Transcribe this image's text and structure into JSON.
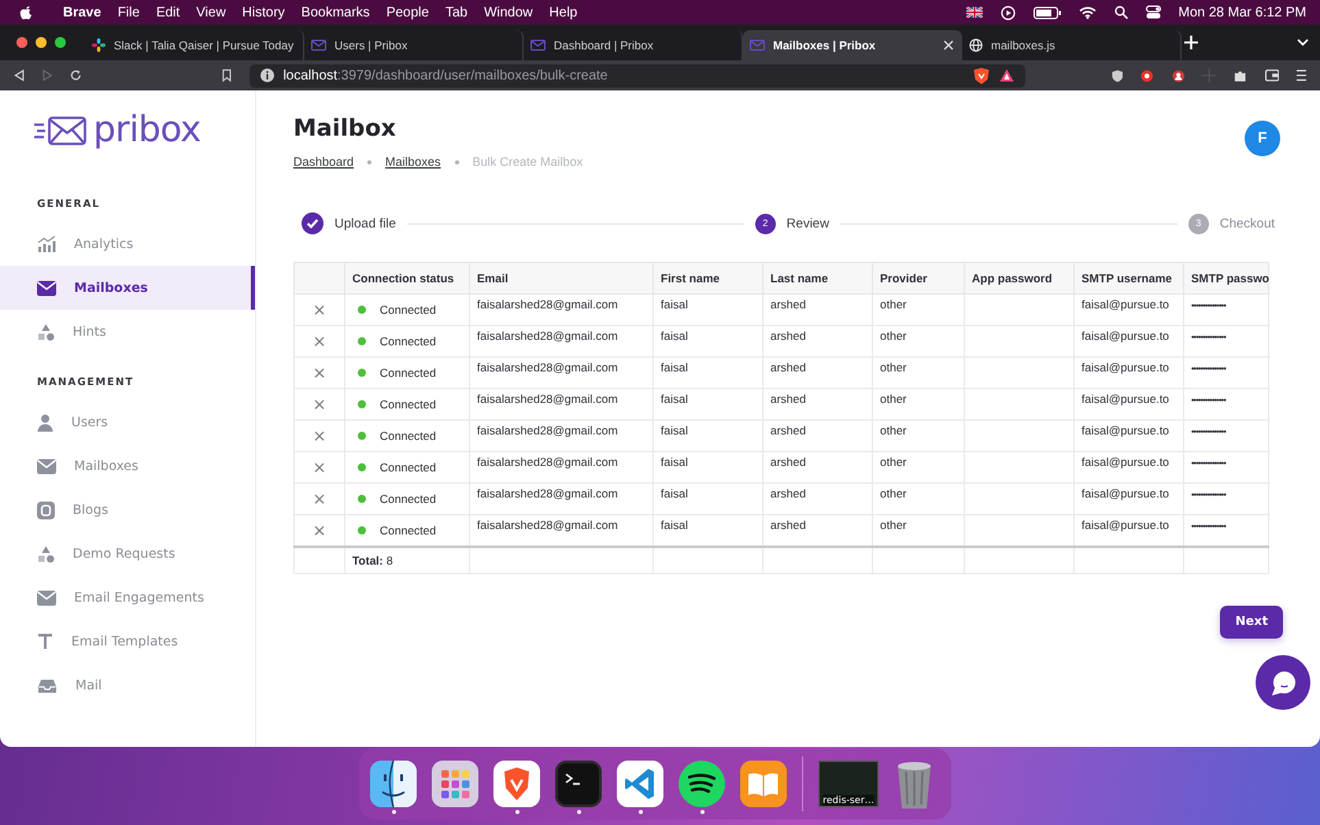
{
  "menubar": {
    "app": "Brave",
    "menus": [
      "File",
      "Edit",
      "View",
      "History",
      "Bookmarks",
      "People",
      "Tab",
      "Window",
      "Help"
    ],
    "clock": "Mon 28 Mar  6:12 PM"
  },
  "tabs": [
    {
      "title": "Slack | Talia Qaiser | Pursue Today",
      "kind": "slack",
      "selected": false
    },
    {
      "title": "Users | Pribox",
      "kind": "pribox",
      "selected": false
    },
    {
      "title": "Dashboard | Pribox",
      "kind": "pribox",
      "selected": false
    },
    {
      "title": "Mailboxes | Pribox",
      "kind": "pribox",
      "selected": true
    },
    {
      "title": "mailboxes.js",
      "kind": "web",
      "selected": false
    }
  ],
  "address": {
    "host": "localhost",
    "path": ":3979/dashboard/user/mailboxes/bulk-create"
  },
  "sidebar": {
    "logo": "pribox",
    "sections": [
      {
        "heading": "GENERAL",
        "items": [
          {
            "label": "Analytics",
            "kind": "chart",
            "selected": false
          },
          {
            "label": "Mailboxes",
            "kind": "mail",
            "selected": true
          },
          {
            "label": "Hints",
            "kind": "shapes",
            "selected": false
          }
        ]
      },
      {
        "heading": "MANAGEMENT",
        "items": [
          {
            "label": "Users",
            "kind": "user",
            "selected": false
          },
          {
            "label": "Mailboxes",
            "kind": "mail",
            "selected": false
          },
          {
            "label": "Blogs",
            "kind": "blog",
            "selected": false
          },
          {
            "label": "Demo Requests",
            "kind": "shapes",
            "selected": false
          },
          {
            "label": "Email Engagements",
            "kind": "mail",
            "selected": false
          },
          {
            "label": "Email Templates",
            "kind": "text",
            "selected": false
          },
          {
            "label": "Mail",
            "kind": "tray",
            "selected": false
          }
        ]
      }
    ]
  },
  "page": {
    "title": "Mailbox",
    "avatar": "F",
    "breadcrumbs": [
      {
        "label": "Dashboard",
        "current": false
      },
      {
        "label": "Mailboxes",
        "current": false
      },
      {
        "label": "Bulk Create Mailbox",
        "current": true
      }
    ],
    "steps": [
      {
        "label": "Upload file",
        "completed": true,
        "current": false
      },
      {
        "label": "Review",
        "number": "2",
        "completed": false,
        "current": true
      },
      {
        "label": "Checkout",
        "number": "3",
        "completed": false,
        "current": false
      }
    ],
    "table": {
      "columns": [
        "Connection status",
        "Email",
        "First name",
        "Last name",
        "Provider",
        "App password",
        "SMTP username",
        "SMTP passwo"
      ],
      "rows": [
        {
          "remove": "×",
          "connected": true,
          "status": "Connected",
          "email": "faisalarshed28@gmail.com",
          "first_name": "faisal",
          "last_name": "arshed",
          "provider": "other",
          "smtp_username": "faisal@pursue.to",
          "smtp_password": "•••••••••••••••"
        },
        {
          "remove": "×",
          "connected": true,
          "status": "Connected",
          "email": "faisalarshed28@gmail.com",
          "first_name": "faisal",
          "last_name": "arshed",
          "provider": "other",
          "smtp_username": "faisal@pursue.to",
          "smtp_password": "•••••••••••••••"
        },
        {
          "remove": "×",
          "connected": true,
          "status": "Connected",
          "email": "faisalarshed28@gmail.com",
          "first_name": "faisal",
          "last_name": "arshed",
          "provider": "other",
          "smtp_username": "faisal@pursue.to",
          "smtp_password": "•••••••••••••••"
        },
        {
          "remove": "×",
          "connected": true,
          "status": "Connected",
          "email": "faisalarshed28@gmail.com",
          "first_name": "faisal",
          "last_name": "arshed",
          "provider": "other",
          "smtp_username": "faisal@pursue.to",
          "smtp_password": "•••••••••••••••"
        },
        {
          "remove": "×",
          "connected": true,
          "status": "Connected",
          "email": "faisalarshed28@gmail.com",
          "first_name": "faisal",
          "last_name": "arshed",
          "provider": "other",
          "smtp_username": "faisal@pursue.to",
          "smtp_password": "•••••••••••••••"
        },
        {
          "remove": "×",
          "connected": true,
          "status": "Connected",
          "email": "faisalarshed28@gmail.com",
          "first_name": "faisal",
          "last_name": "arshed",
          "provider": "other",
          "smtp_username": "faisal@pursue.to",
          "smtp_password": "•••••••••••••••"
        },
        {
          "remove": "×",
          "connected": true,
          "status": "Connected",
          "email": "faisalarshed28@gmail.com",
          "first_name": "faisal",
          "last_name": "arshed",
          "provider": "other",
          "smtp_username": "faisal@pursue.to",
          "smtp_password": "•••••••••••••••"
        },
        {
          "remove": "×",
          "connected": true,
          "status": "Connected",
          "email": "faisalarshed28@gmail.com",
          "first_name": "faisal",
          "last_name": "arshed",
          "provider": "other",
          "smtp_username": "faisal@pursue.to",
          "smtp_password": "•••••••••••••••"
        }
      ],
      "total": "**Total:** 8"
    },
    "next_button": "Next"
  },
  "dock": [
    {
      "kind": "finder",
      "running": true
    },
    {
      "kind": "launchpad",
      "running": false
    },
    {
      "kind": "brave",
      "running": true
    },
    {
      "kind": "terminal",
      "running": true
    },
    {
      "kind": "vscode",
      "running": true
    },
    {
      "kind": "spotify",
      "running": true
    },
    {
      "kind": "books",
      "running": false
    },
    {
      "kind": "window",
      "label": "redis-ser…",
      "running": false
    },
    {
      "kind": "trash",
      "running": false
    }
  ]
}
